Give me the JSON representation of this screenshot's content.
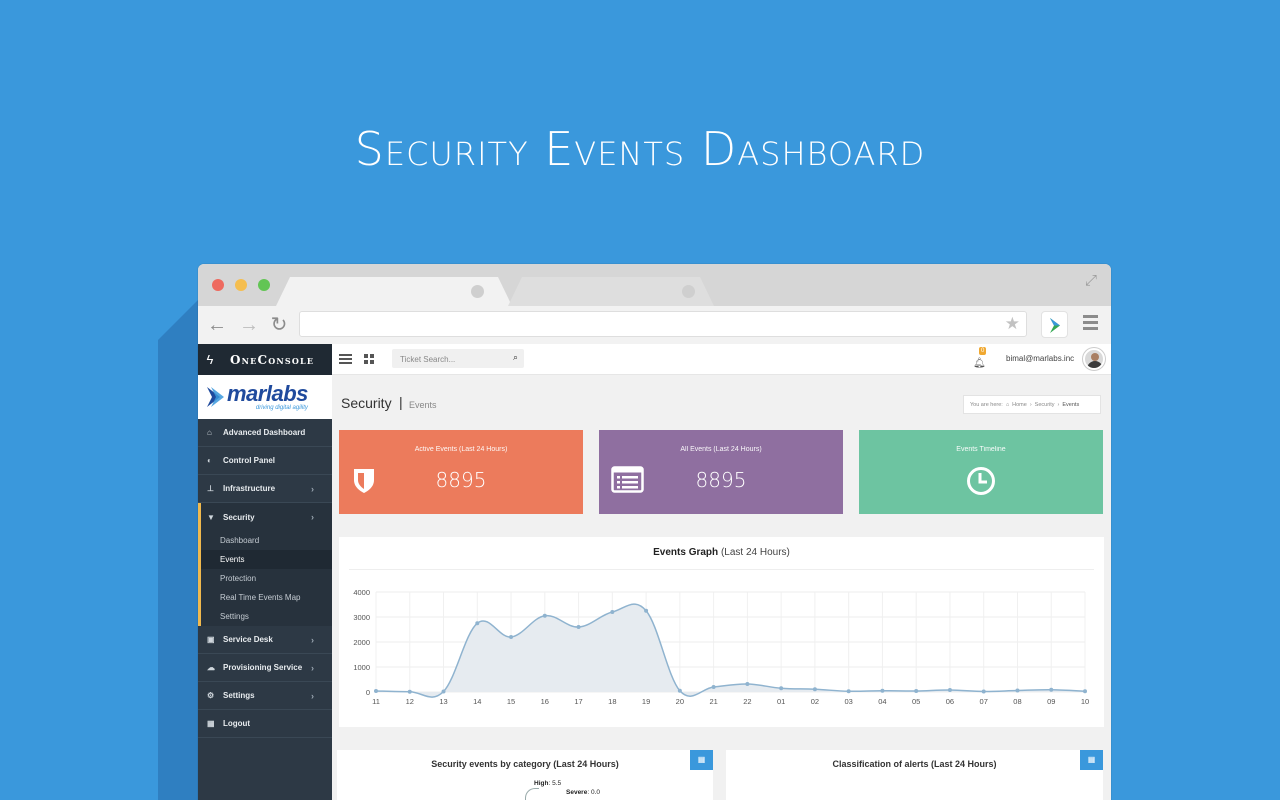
{
  "hero": {
    "title": "Security Events Dashboard"
  },
  "browser": {
    "url": ""
  },
  "app": {
    "brand": "OneConsole",
    "logo": {
      "word": "marlabs",
      "tagline": "driving digital agility"
    },
    "sidebar": {
      "items": [
        {
          "label": "Advanced Dashboard",
          "icon": "home-icon"
        },
        {
          "label": "Control Panel",
          "icon": "toggle-icon"
        },
        {
          "label": "Infrastructure",
          "icon": "sitemap-icon",
          "has_children": true
        },
        {
          "label": "Security",
          "icon": "shield-icon",
          "has_children": true,
          "active": true
        },
        {
          "label": "Service Desk",
          "icon": "briefcase-icon",
          "has_children": true
        },
        {
          "label": "Provisioning Service",
          "icon": "cloud-icon",
          "has_children": true
        },
        {
          "label": "Settings",
          "icon": "gears-icon",
          "has_children": true
        },
        {
          "label": "Logout",
          "icon": "calendar-icon"
        }
      ],
      "security_sub": [
        "Dashboard",
        "Events",
        "Protection",
        "Real Time Events Map",
        "Settings"
      ],
      "selected_sub": "Events"
    },
    "topbar": {
      "search_placeholder": "Ticket Search...",
      "notification_count": "0",
      "user_email": "bimal@marlabs.inc"
    },
    "page": {
      "title": "Security",
      "separator": "|",
      "subtitle": "Events",
      "breadcrumb": {
        "prefix": "You are here:",
        "items": [
          "Home",
          "Security",
          "Events"
        ]
      }
    },
    "cards": [
      {
        "label": "Active Events (Last 24 Hours)",
        "value": "8895",
        "color": "#ec7b5c",
        "icon": "shield-icon"
      },
      {
        "label": "All Events (Last 24 Hours)",
        "value": "8895",
        "color": "#8f6fa0",
        "icon": "list-icon"
      },
      {
        "label": "Events Timeline",
        "value": "",
        "color": "#6dc4a1",
        "icon": "clock-icon"
      }
    ],
    "graph": {
      "title_bold": "Events Graph",
      "title_rest": "(Last 24 Hours)"
    },
    "panels": [
      {
        "title": "Security events by category (Last 24 Hours)",
        "labels": [
          {
            "name": "High",
            "value": "5.5"
          },
          {
            "name": "Severe",
            "value": "0.0"
          }
        ]
      },
      {
        "title": "Classification of alerts (Last 24 Hours)"
      }
    ]
  },
  "chart_data": {
    "type": "area",
    "title": "Events Graph (Last 24 Hours)",
    "x": [
      "11",
      "12",
      "13",
      "14",
      "15",
      "16",
      "17",
      "18",
      "19",
      "20",
      "21",
      "22",
      "01",
      "02",
      "03",
      "04",
      "05",
      "06",
      "07",
      "08",
      "09",
      "10"
    ],
    "series": [
      {
        "values": [
          40,
          10,
          20,
          2750,
          2200,
          3050,
          2600,
          3200,
          3250,
          50,
          200,
          320,
          150,
          110,
          30,
          50,
          40,
          80,
          20,
          60,
          90,
          30
        ]
      }
    ],
    "ylim": [
      0,
      4000
    ],
    "yticks": [
      0,
      1000,
      2000,
      3000,
      4000
    ],
    "grid": true,
    "colors": {
      "line": "#8fb3cf",
      "fill": "#e6ebf0",
      "point": "#8fb3cf"
    }
  }
}
